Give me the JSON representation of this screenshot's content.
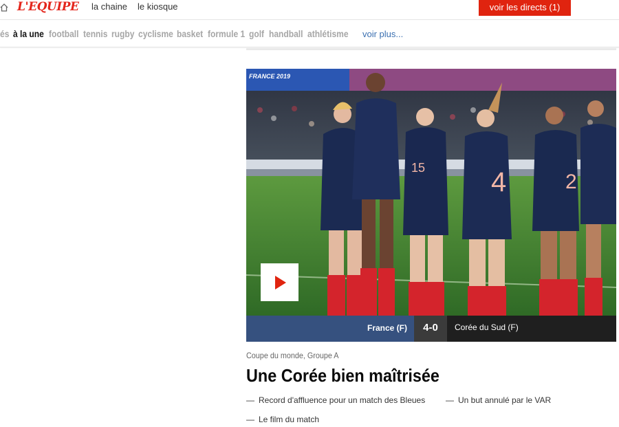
{
  "header": {
    "logo_text": "L'EQUIPE",
    "links": [
      "la chaine",
      "le kiosque"
    ],
    "live_button": "voir les directs (1)"
  },
  "sport_nav": {
    "items": [
      "és",
      "à la une",
      "football",
      "tennis",
      "rugby",
      "cyclisme",
      "basket",
      "formule 1",
      "golf",
      "handball",
      "athlétisme"
    ],
    "active": "à la une",
    "more": "voir plus..."
  },
  "article": {
    "image_banner_text": "FRANCE 2019",
    "scoreboard": {
      "home_team": "France (F)",
      "score": "4-0",
      "away_team": "Corée du Sud (F)"
    },
    "kicker": "Coupe du monde, Groupe A",
    "headline": "Une Corée bien maîtrisée",
    "related": [
      "Record d'affluence pour un match des Bleues",
      "Un but annulé par le VAR",
      "Le film du match"
    ]
  },
  "colors": {
    "brand_red": "#e0240f",
    "nav_inactive": "#a6a6a6",
    "home_bar": "#36517f"
  },
  "icons": [
    "home-icon",
    "play-icon"
  ]
}
